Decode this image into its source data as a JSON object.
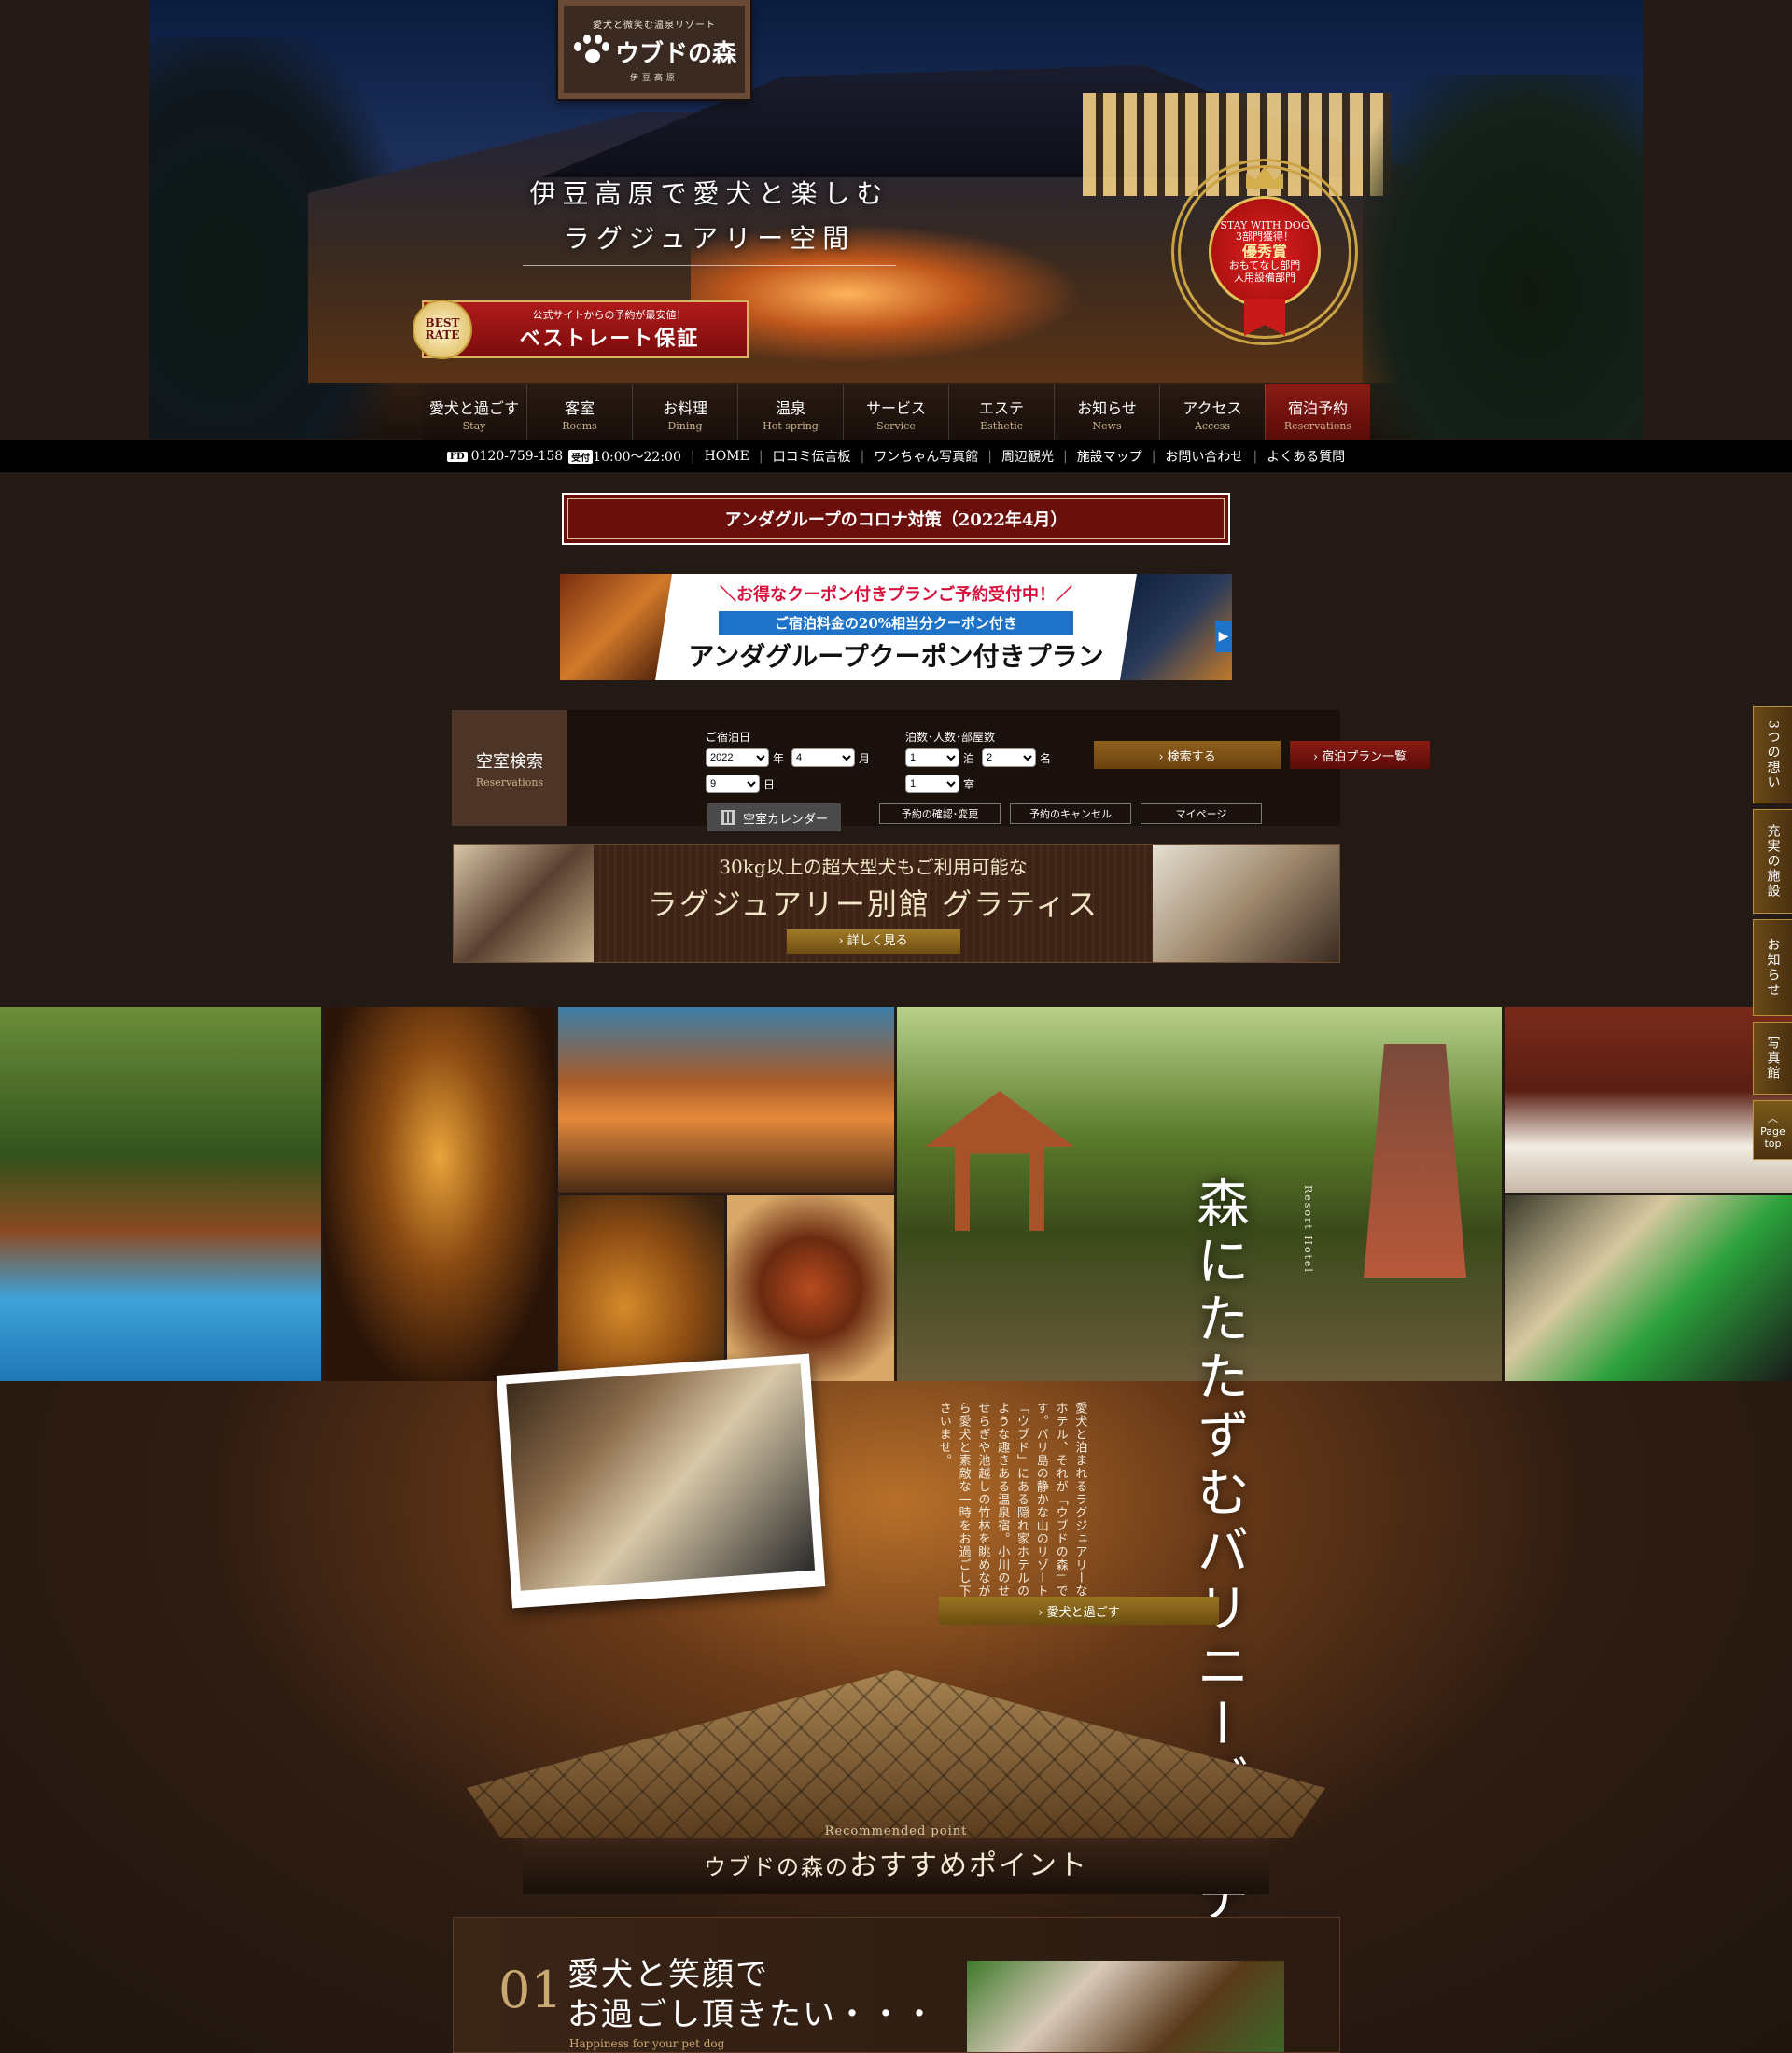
{
  "hero": {
    "logo_tagline": "愛犬と微笑む温泉リゾート",
    "logo_name": "ウブドの森",
    "logo_location": "伊豆高原",
    "catch_line1": "伊豆高原で愛犬と楽しむ",
    "catch_line2": "ラグジュアリー空間",
    "best_rate_medal": "BEST RATE",
    "best_rate_sub": "公式サイトからの予約が最安値！",
    "best_rate_main": "ベストレート保証",
    "award_top": "STAY WITH DOG",
    "award_mid": "3部門獲得！",
    "award_big": "優秀賞",
    "award_l1": "おもてなし部門",
    "award_l2": "人用設備部門"
  },
  "nav": [
    {
      "jp": "愛犬と過ごす",
      "en": "Stay"
    },
    {
      "jp": "客室",
      "en": "Rooms"
    },
    {
      "jp": "お料理",
      "en": "Dining"
    },
    {
      "jp": "温泉",
      "en": "Hot spring"
    },
    {
      "jp": "サービス",
      "en": "Service"
    },
    {
      "jp": "エステ",
      "en": "Esthetic"
    },
    {
      "jp": "お知らせ",
      "en": "News"
    },
    {
      "jp": "アクセス",
      "en": "Access"
    },
    {
      "jp": "宿泊予約",
      "en": "Reservations"
    }
  ],
  "subbar": {
    "freedial_icon": "FD",
    "phone": "0120-759-158",
    "hours_badge": "受付",
    "hours": "10:00～22:00",
    "links": [
      "HOME",
      "口コミ伝言板",
      "ワンちゃん写真館",
      "周辺観光",
      "施設マップ",
      "お問い合わせ",
      "よくある質問"
    ]
  },
  "corona_label": "アンダグループのコロナ対策（2022年4月）",
  "coupon": {
    "line1": "＼お得なクーポン付きプランご予約受付中！／",
    "line2": "ご宿泊料金の20%相当分クーポン付き",
    "line3": "アンダグループクーポン付きプラン",
    "arrow": "▶"
  },
  "search": {
    "title_jp": "空室検索",
    "title_en": "Reservations",
    "date_label": "ご宿泊日",
    "year": "2022",
    "year_unit": "年",
    "month": "4",
    "month_unit": "月",
    "day": "9",
    "day_unit": "日",
    "stay_label": "泊数･人数･部屋数",
    "nights": "1",
    "nights_unit": "泊",
    "people": "2",
    "people_unit": "名",
    "rooms": "1",
    "rooms_unit": "室",
    "search_button": "› 検索する",
    "plans_button": "› 宿泊プラン一覧",
    "calendar_button": "空室カレンダー",
    "confirm_button": "予約の確認･変更",
    "cancel_button": "予約のキャンセル",
    "mypage_button": "マイページ"
  },
  "gratis": {
    "line1": "30kg以上の超大型犬もご利用可能な",
    "line2": "ラグジュアリー別館 グラティス",
    "button": "› 詳しく見る"
  },
  "intro": {
    "title": "森にたたずむバリニーズホテル",
    "resort_label": "Resort Hotel",
    "body": "愛犬と泊まれるラグジュアリーなホテル、それが「ウブドの森」です。バリ島の静かな山のリゾート「ウブド」にある隠れ家ホテルのような趣きある温泉宿。小川のせせらぎや池越しの竹林を眺めながら愛犬と素敵な一時をお過ごし下さいませ。",
    "button": "› 愛犬と過ごす"
  },
  "recommend": {
    "en": "Recommended point",
    "jp_pre": "ウブドの森の",
    "jp_main": "おすすめポイント"
  },
  "point1": {
    "num": "01",
    "title_l1": "愛犬と笑顔で",
    "title_l2": "お過ごし頂きたい・・・",
    "en": "Happiness for your pet dog"
  },
  "sidetabs": [
    "3つの想い",
    "充実の施設",
    "お知らせ",
    "写真館"
  ],
  "pagetop": {
    "l1": "Page",
    "l2": "top"
  }
}
